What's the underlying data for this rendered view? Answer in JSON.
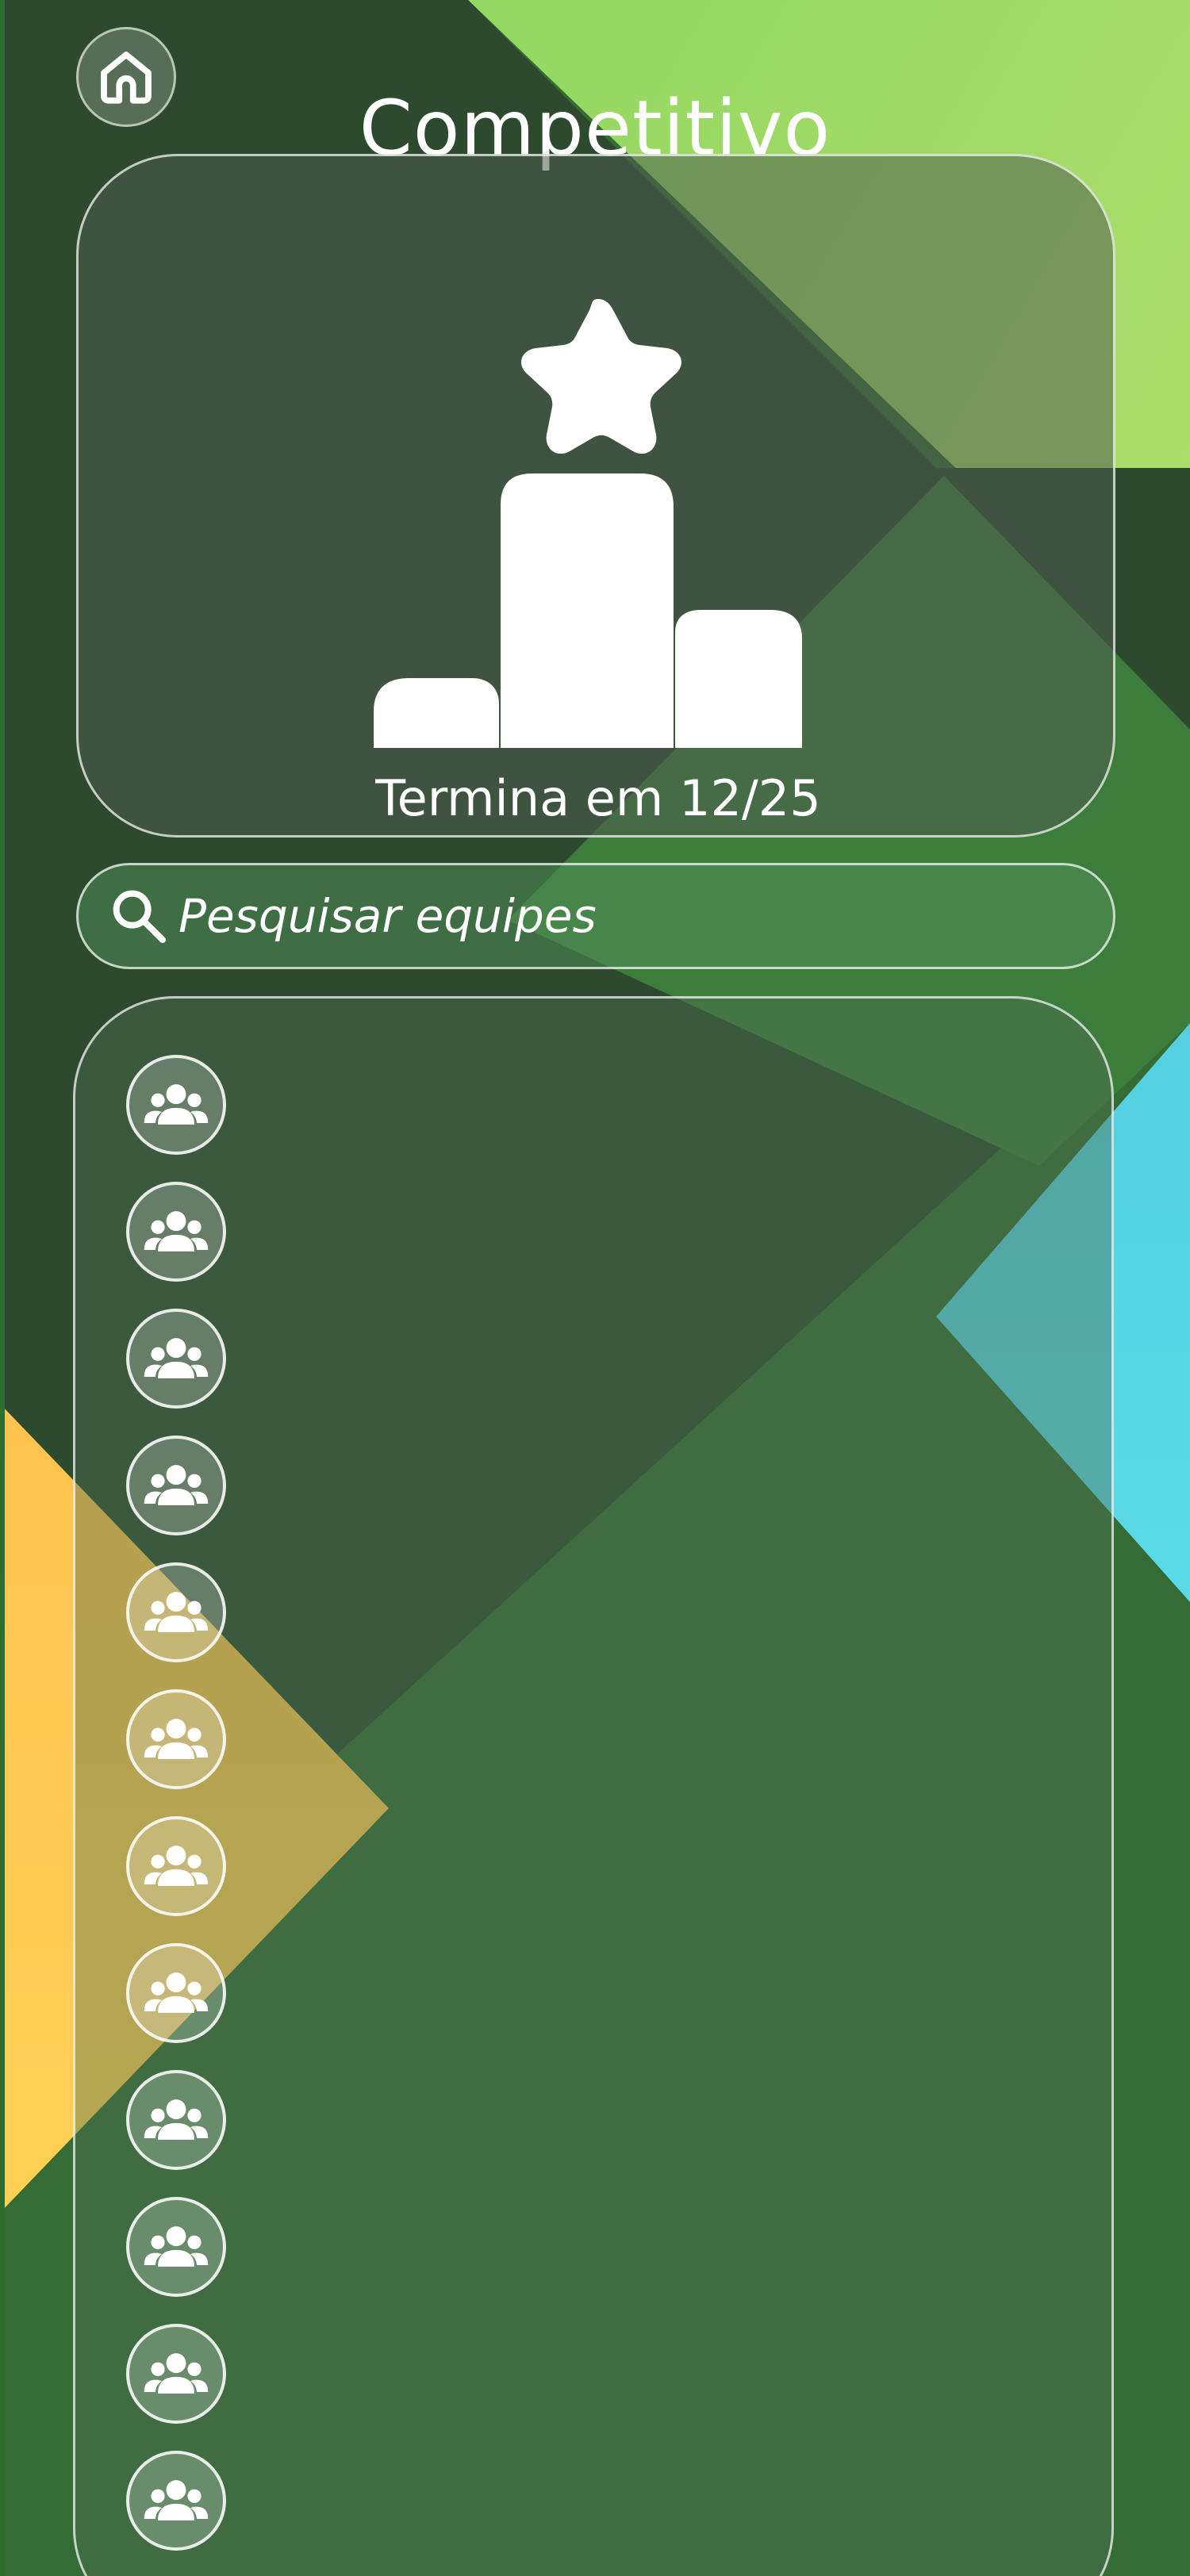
{
  "header": {
    "title": "Competitivo",
    "home_icon": "home-icon"
  },
  "competition": {
    "end_label": "Termina em 12/25",
    "trophy_icon": "star-podium-icon"
  },
  "search": {
    "placeholder": "Pesquisar equipes",
    "value": "",
    "icon": "search-icon"
  },
  "teams": {
    "icon": "team-group-icon",
    "count_visible": 12
  },
  "colors": {
    "text": "#ffffff",
    "accent_green": "#86d65c",
    "cyan": "#5ad9e6",
    "yellow": "#ffc64f",
    "dark_green": "#2d4a2f"
  }
}
